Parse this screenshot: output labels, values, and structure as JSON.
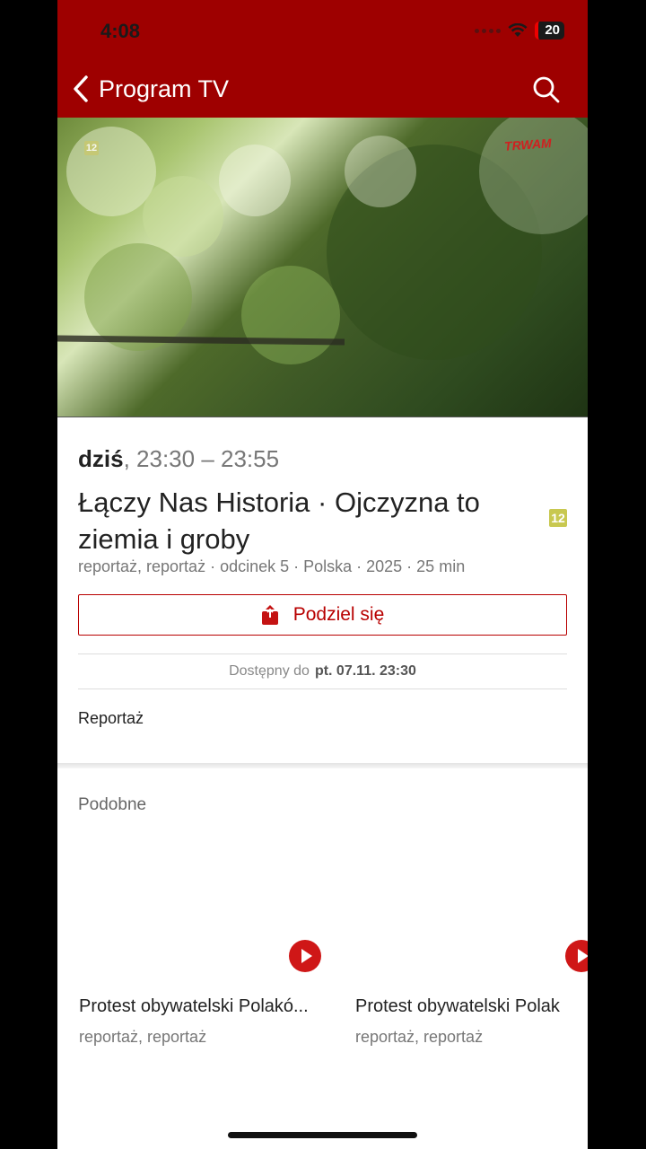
{
  "status_bar": {
    "time": "4:08",
    "battery": "20"
  },
  "nav": {
    "title": "Program TV"
  },
  "video": {
    "age_rating": "12",
    "channel": "TRWAM"
  },
  "program": {
    "day": "dziś",
    "time_range": ", 23:30 – 23:55",
    "title": "Łączy Nas Historia · Ojczyzna to ziemia i groby",
    "age_rating": "12",
    "meta": "reportaż, reportaż · odcinek 5 · Polska · 2025 · 25 min"
  },
  "share": {
    "label": "Podziel się"
  },
  "availability": {
    "label": "Dostępny do",
    "value": "pt. 07.11. 23:30"
  },
  "genre": "Reportaż",
  "similar": {
    "heading": "Podobne",
    "items": [
      {
        "title": "Protest obywatelski Polakó...",
        "subtitle": "reportaż, reportaż"
      },
      {
        "title": "Protest obywatelski Polak",
        "subtitle": "reportaż, reportaż"
      }
    ]
  },
  "colors": {
    "brand": "#9e0000",
    "accent": "#b80000",
    "play": "#cf1717"
  }
}
